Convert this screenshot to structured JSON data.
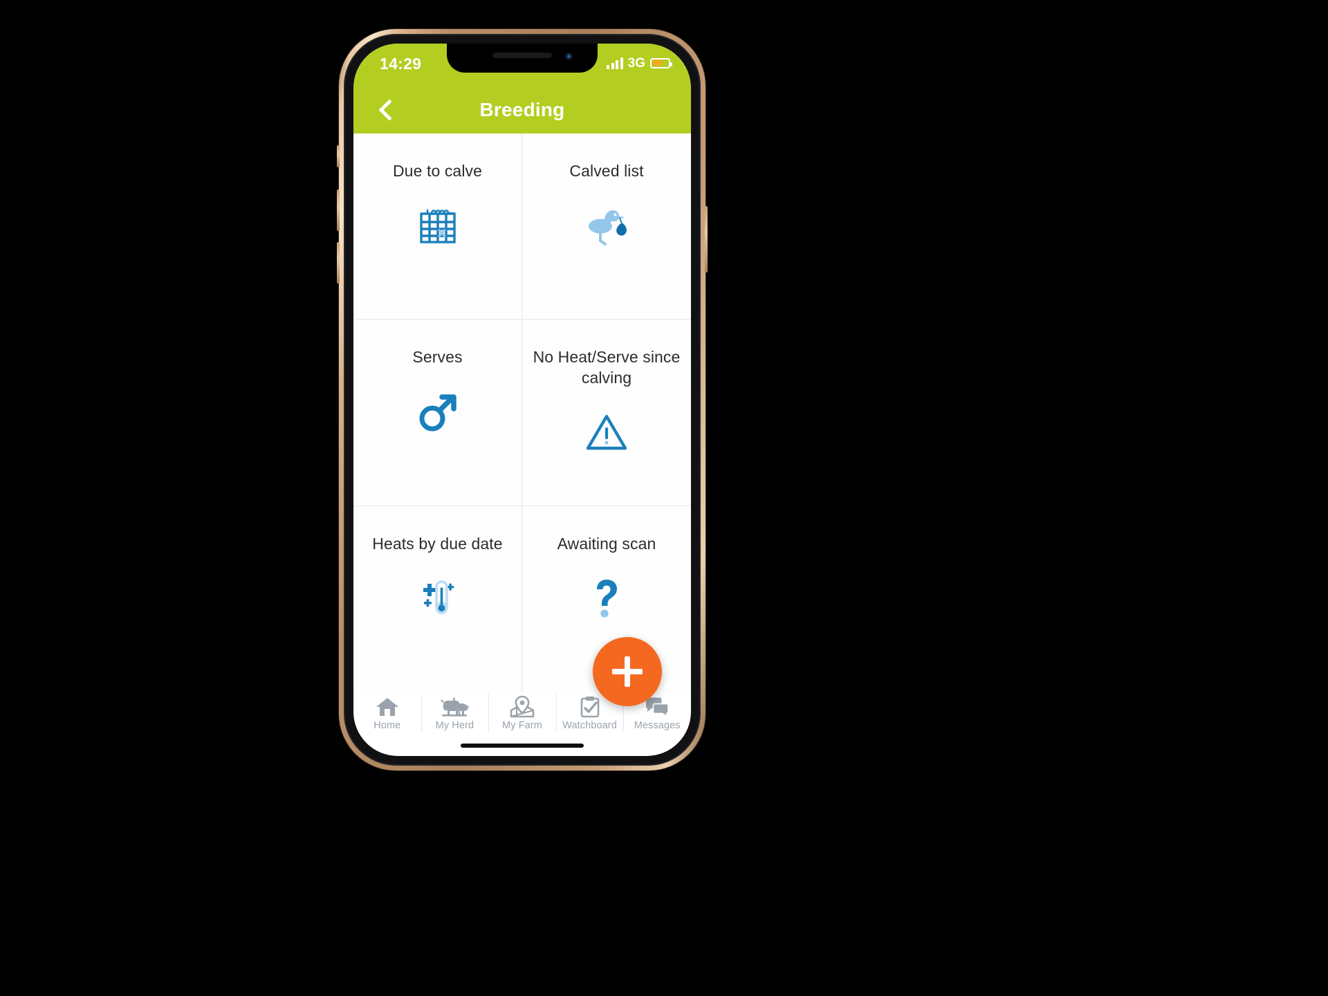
{
  "theme": {
    "brand_green": "#b4cd21",
    "accent_orange": "#f4691f",
    "icon_blue": "#1b7fbc",
    "icon_light_blue": "#93c6ea",
    "tab_grey": "#9aa3ab",
    "text_dark": "#2c2c2c"
  },
  "status_bar": {
    "time": "14:29",
    "network": "3G",
    "signal_icon": "signal-bars-icon",
    "battery_icon": "battery-icon",
    "battery_percent": 55
  },
  "header": {
    "title": "Breeding",
    "back_icon": "back-chevron-icon"
  },
  "grid": {
    "items": [
      {
        "label": "Due to calve",
        "icon": "calendar-icon"
      },
      {
        "label": "Calved list",
        "icon": "stork-icon"
      },
      {
        "label": "Serves",
        "icon": "male-symbol-icon"
      },
      {
        "label": "No Heat/Serve since calving",
        "icon": "warning-triangle-icon"
      },
      {
        "label": "Heats by due date",
        "icon": "thermometer-icon"
      },
      {
        "label": "Awaiting scan",
        "icon": "question-mark-icon"
      }
    ]
  },
  "fab": {
    "label": "+",
    "icon": "plus-icon"
  },
  "tabbar": {
    "items": [
      {
        "label": "Home",
        "icon": "home-icon"
      },
      {
        "label": "My Herd",
        "icon": "cattle-icon"
      },
      {
        "label": "My Farm",
        "icon": "map-pin-icon"
      },
      {
        "label": "Watchboard",
        "icon": "clipboard-check-icon"
      },
      {
        "label": "Messages",
        "icon": "chat-bubbles-icon"
      }
    ]
  }
}
